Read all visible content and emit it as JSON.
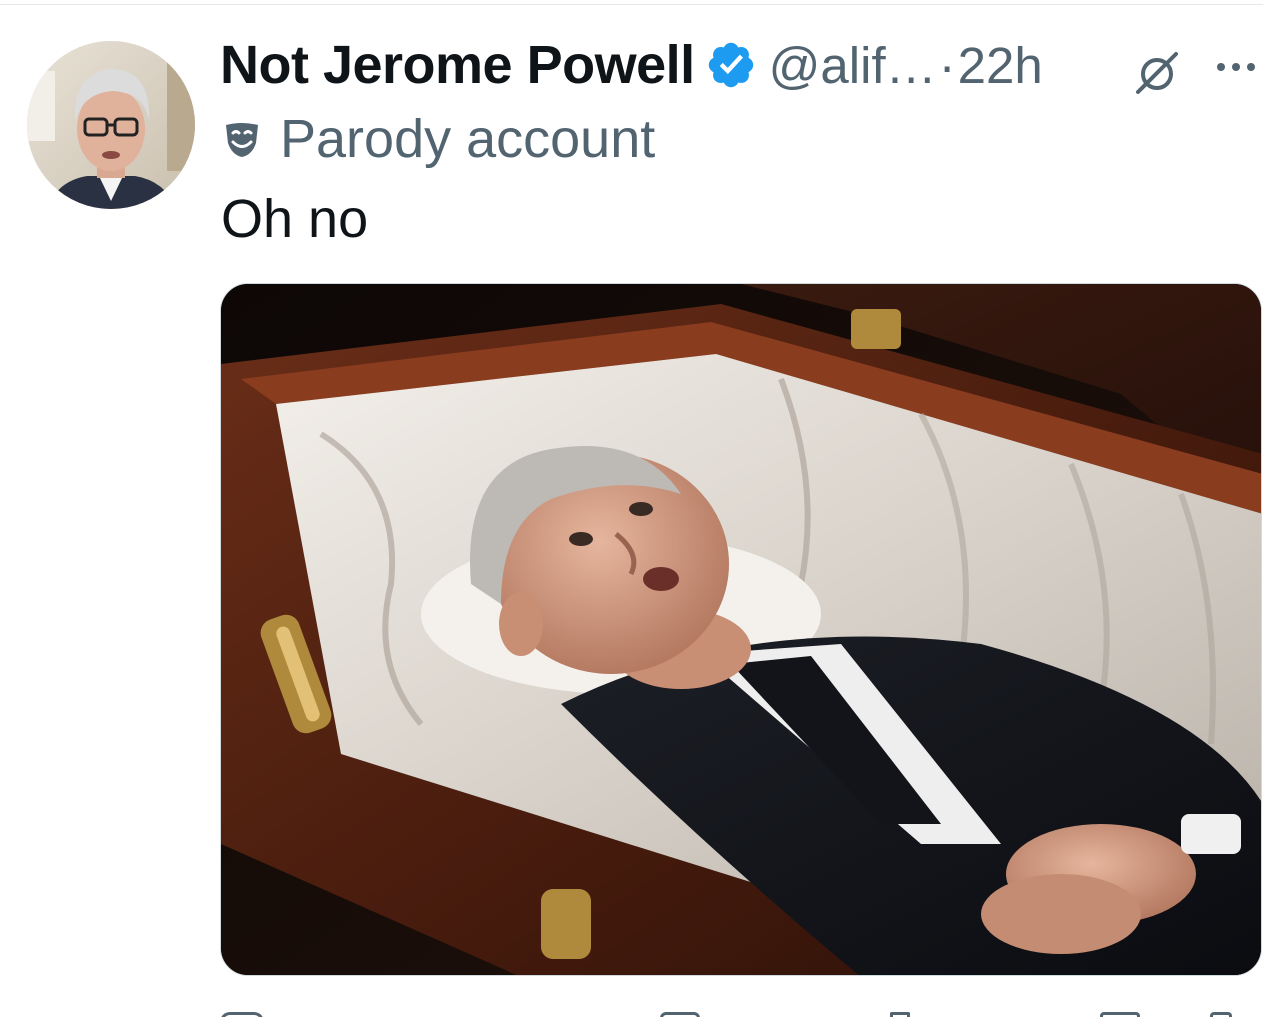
{
  "tweet": {
    "author": {
      "display_name": "Not Jerome Powell",
      "handle": "@alif…",
      "verified": true,
      "avatar": "avatar"
    },
    "separator": "·",
    "timestamp": "22h",
    "label": {
      "icon": "mask-icon",
      "text": "Parody account"
    },
    "text": "Oh no",
    "media": {
      "type": "photo"
    },
    "header_icons": [
      "grok-icon",
      "more-icon"
    ],
    "actions": [
      "reply-icon",
      "retweet-icon",
      "like-icon",
      "views-icon",
      "bookmark-icon",
      "share-icon"
    ]
  },
  "colors": {
    "text_primary": "#0f1419",
    "text_secondary": "#536471",
    "verified_blue": "#1d9bf0",
    "divider": "#e6e9ec"
  }
}
